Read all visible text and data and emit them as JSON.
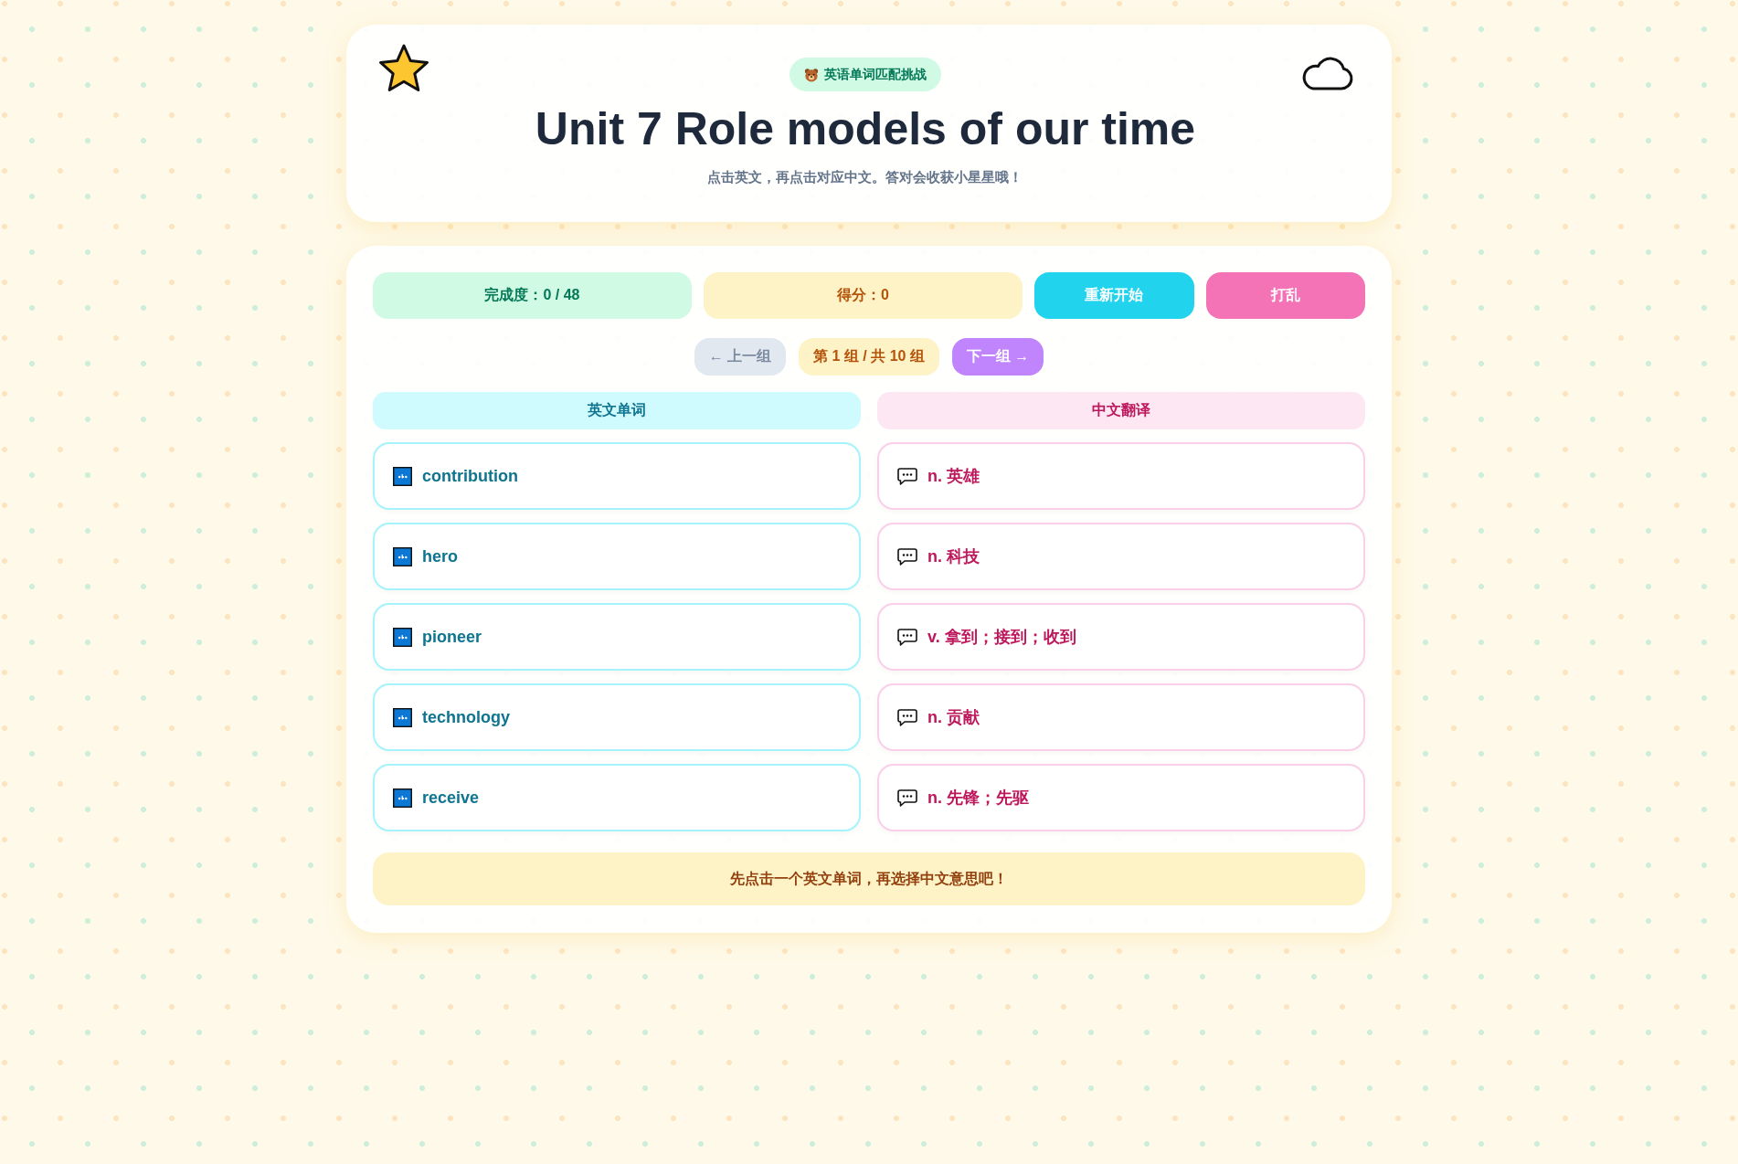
{
  "header": {
    "badge": "英语单词匹配挑战",
    "title": "Unit 7 Role models of our time",
    "subtitle": "点击英文，再点击对应中文。答对会收获小星星哦！"
  },
  "stats": [
    {
      "kind": "progress",
      "text": "完成度：0 / 48"
    },
    {
      "kind": "score",
      "text": "得分：0"
    }
  ],
  "actions": [
    {
      "kind": "restart",
      "label": "重新开始"
    },
    {
      "kind": "shuffle",
      "label": "打乱"
    }
  ],
  "pager": {
    "prev": {
      "label": "← 上一组",
      "disabled": true
    },
    "indicator": "第 1 组 / 共 10 组",
    "next": {
      "label": "下一组 →",
      "disabled": false
    }
  },
  "columns": [
    {
      "kind": "english",
      "heading": "英文单词",
      "items": [
        {
          "text": "contribution",
          "selected": false
        },
        {
          "text": "hero",
          "selected": false
        },
        {
          "text": "pioneer",
          "selected": false
        },
        {
          "text": "technology",
          "selected": false
        },
        {
          "text": "receive",
          "selected": false
        }
      ]
    },
    {
      "kind": "chinese",
      "heading": "中文翻译",
      "items": [
        {
          "text": "n. 英雄",
          "selected": false
        },
        {
          "text": "n. 科技",
          "selected": false
        },
        {
          "text": "v. 拿到；接到；收到",
          "selected": false
        },
        {
          "text": "n. 贡献",
          "selected": false
        },
        {
          "text": "n. 先锋；先驱",
          "selected": false
        }
      ]
    }
  ],
  "message": "先点击一个英文单词，再选择中文意思吧！"
}
